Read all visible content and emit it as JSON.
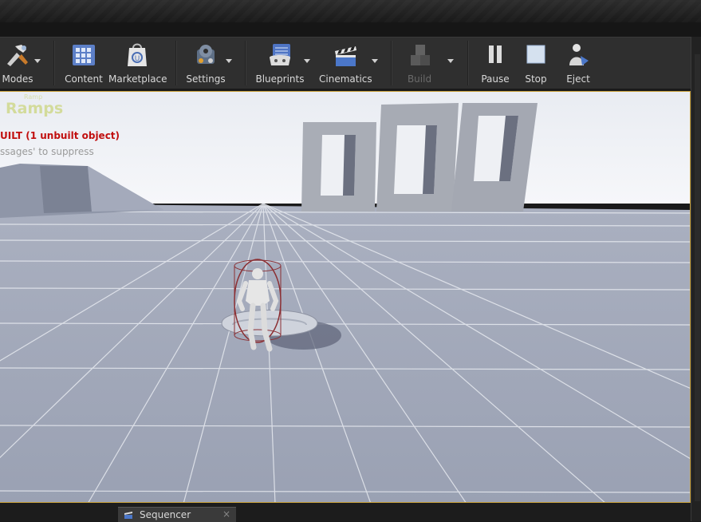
{
  "toolbar": {
    "buttons": [
      {
        "label": "Modes",
        "icon": "modes-icon",
        "has_dropdown": true
      },
      {
        "label": "Content",
        "icon": "content-icon",
        "has_dropdown": false
      },
      {
        "label": "Marketplace",
        "icon": "marketplace-icon",
        "has_dropdown": false
      },
      {
        "label": "Settings",
        "icon": "settings-icon",
        "has_dropdown": true
      },
      {
        "label": "Blueprints",
        "icon": "blueprints-icon",
        "has_dropdown": true
      },
      {
        "label": "Cinematics",
        "icon": "cinematics-icon",
        "has_dropdown": true
      },
      {
        "label": "Build",
        "icon": "build-icon",
        "has_dropdown": true,
        "disabled": true
      },
      {
        "label": "Pause",
        "icon": "pause-icon",
        "has_dropdown": false
      },
      {
        "label": "Stop",
        "icon": "stop-icon",
        "has_dropdown": false
      },
      {
        "label": "Eject",
        "icon": "eject-icon",
        "has_dropdown": false
      }
    ]
  },
  "viewport": {
    "level_name": "Ramps",
    "level_name_small": "Ramp",
    "warning": "UILT (1 unbuilt object)",
    "note": "ssages' to suppress"
  },
  "bottom": {
    "tab_label": "Sequencer",
    "tab_close": "×"
  },
  "colors": {
    "accent": "#c9a13a",
    "warning": "#c10f0f",
    "overlay_title": "#cfd88c"
  }
}
